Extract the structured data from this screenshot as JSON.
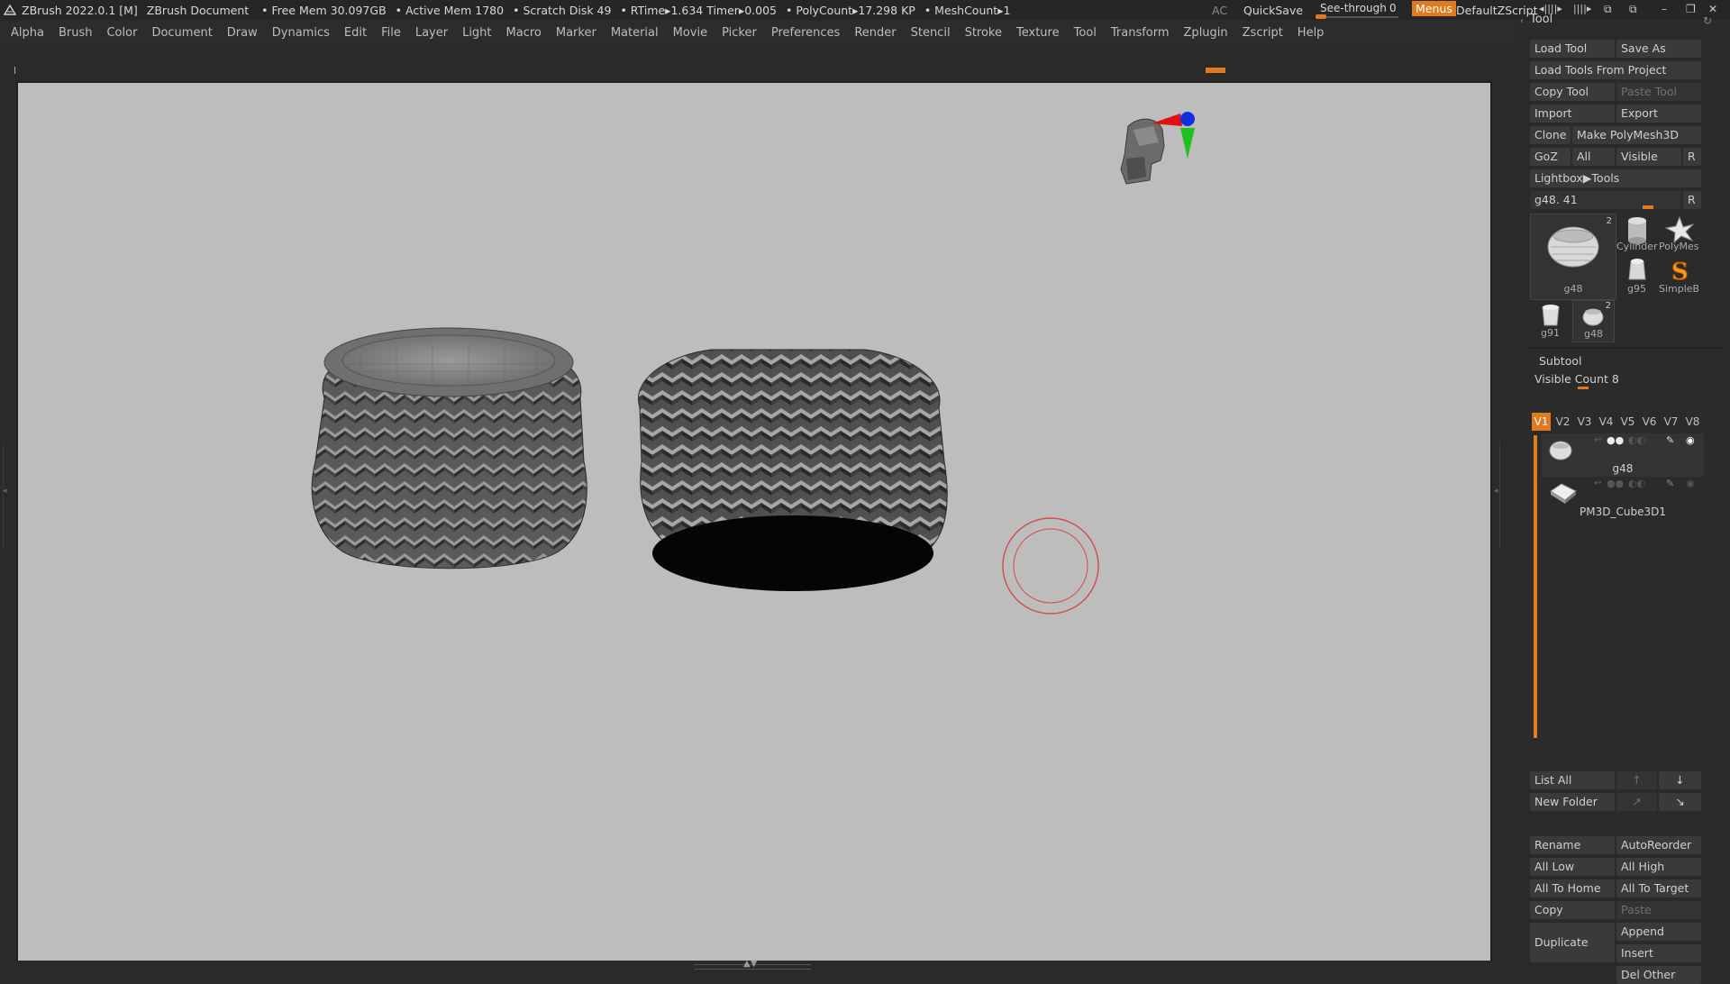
{
  "topbar": {
    "title": "ZBrush 2022.0.1 [M]",
    "document": "ZBrush Document",
    "free_mem": "• Free Mem 30.097GB",
    "active_mem": "• Active Mem 1780",
    "scratch": "• Scratch Disk 49",
    "rtime": "• RTime▸1.634 Timer▸0.005",
    "polycount": "• PolyCount▸17.298 KP",
    "meshcount": "• MeshCount▸1",
    "ac": "AC",
    "quicksave": "QuickSave",
    "seethrough_label": "See-through",
    "seethrough_value": "0",
    "menus": "Menus",
    "zscript": "DefaultZScript"
  },
  "menubar": [
    "Alpha",
    "Brush",
    "Color",
    "Document",
    "Draw",
    "Dynamics",
    "Edit",
    "File",
    "Layer",
    "Light",
    "Macro",
    "Marker",
    "Material",
    "Movie",
    "Picker",
    "Preferences",
    "Render",
    "Stencil",
    "Stroke",
    "Texture",
    "Tool",
    "Transform",
    "Zplugin",
    "Zscript",
    "Help"
  ],
  "tool": {
    "title": "Tool",
    "load_tool": "Load Tool",
    "save_as": "Save As",
    "load_tools_from_project": "Load Tools From Project",
    "copy_tool": "Copy Tool",
    "paste_tool": "Paste Tool",
    "import": "Import",
    "export": "Export",
    "clone": "Clone",
    "make_polymesh": "Make PolyMesh3D",
    "goz": "GoZ",
    "all": "All",
    "visible": "Visible",
    "r": "R",
    "lightbox_tools": "Lightbox▶Tools",
    "slider_label": "g48. 41",
    "slider_r": "R",
    "thumbs": [
      {
        "label": "g48",
        "badge": "2"
      },
      {
        "label": "Cylinder"
      },
      {
        "label": "PolyMes"
      },
      {
        "label": "g95"
      },
      {
        "label": "SimpleB"
      },
      {
        "label": "g91"
      },
      {
        "label": "g48",
        "badge": "2"
      }
    ]
  },
  "subtool": {
    "title": "Subtool",
    "visible_count": "Visible Count 8",
    "tabs": [
      "V1",
      "V2",
      "V3",
      "V4",
      "V5",
      "V6",
      "V7",
      "V8"
    ],
    "items": [
      {
        "name": "g48"
      },
      {
        "name": "PM3D_Cube3D1"
      }
    ],
    "list_all": "List All",
    "new_folder": "New Folder",
    "rename": "Rename",
    "autoreorder": "AutoReorder",
    "all_low": "All Low",
    "all_high": "All High",
    "all_to_home": "All To Home",
    "all_to_target": "All To Target",
    "copy": "Copy",
    "paste": "Paste",
    "duplicate": "Duplicate",
    "append": "Append",
    "insert": "Insert",
    "del_other": "Del Other"
  },
  "colors": {
    "accent": "#e07a1f",
    "canvas_bg": "#bdbdbd",
    "panel_bg": "#2b2b2b",
    "button_bg": "#3a3a3a"
  }
}
